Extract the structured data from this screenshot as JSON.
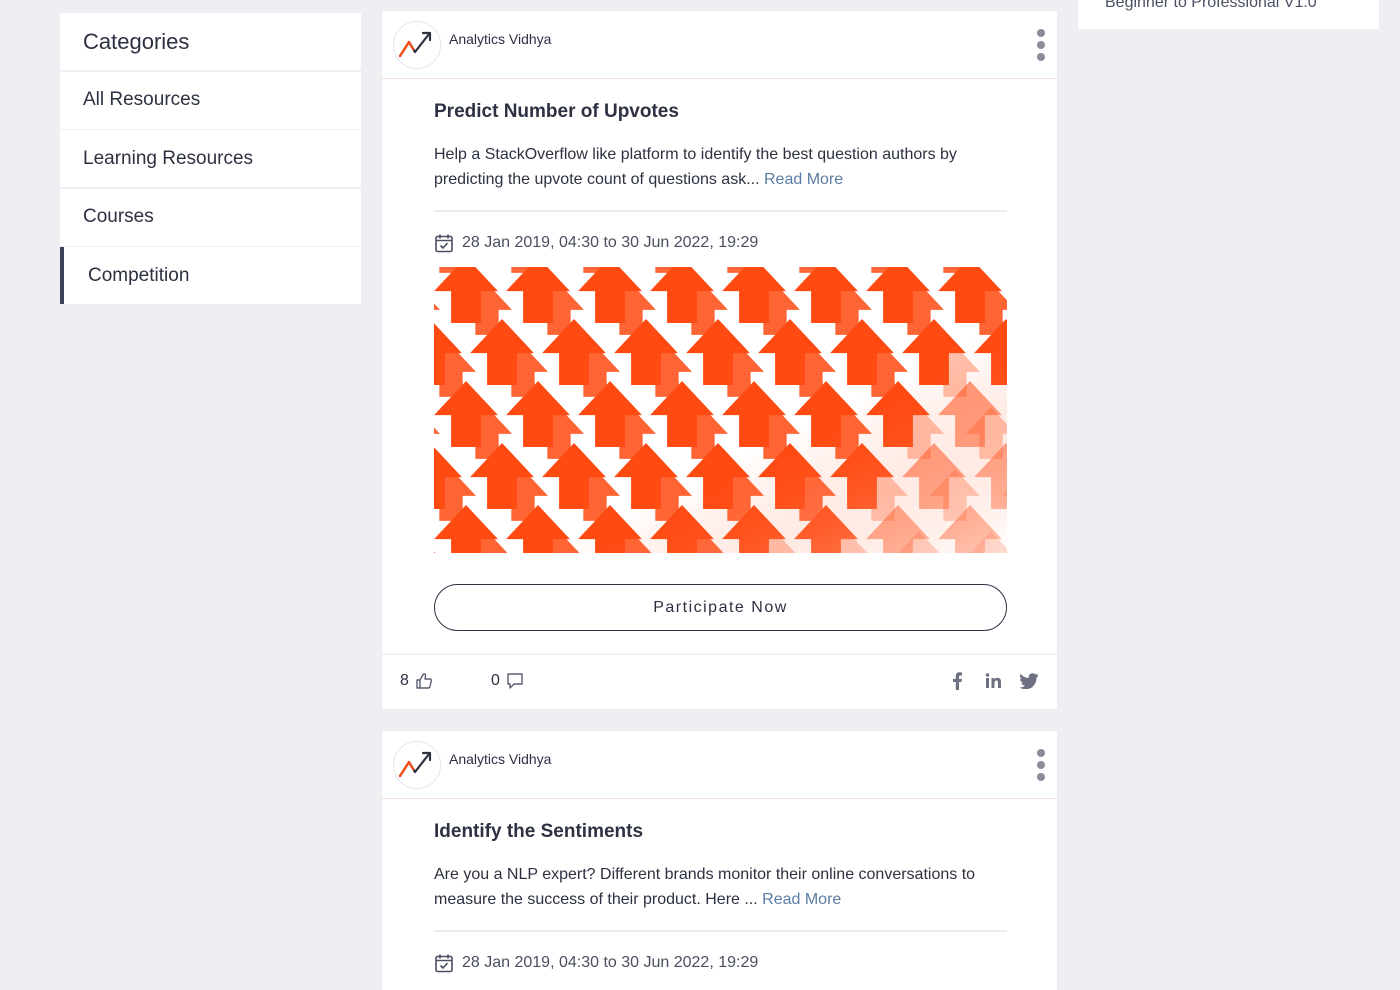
{
  "sidebar": {
    "header": "Categories",
    "items": [
      {
        "label": "All Resources"
      },
      {
        "label": "Learning Resources"
      },
      {
        "label": "Courses"
      },
      {
        "label": "Competition",
        "active": true
      }
    ]
  },
  "right_widget": {
    "text": "Beginner to Professional V1.0"
  },
  "cards": [
    {
      "author": "Analytics Vidhya",
      "title": "Predict Number of Upvotes",
      "description": "Help a StackOverflow like platform to identify the best question authors by predicting the upvote count of questions ask...",
      "read_more": "Read More",
      "date_range": "28 Jan 2019, 04:30 to 30 Jun 2022, 19:29",
      "button": "Participate Now",
      "likes": "8",
      "comments": "0"
    },
    {
      "author": "Analytics Vidhya",
      "title": "Identify the Sentiments",
      "description": "Are you a NLP expert? Different brands monitor their online conversations to measure the success of their product. Here ...",
      "read_more": "Read More",
      "date_range": "28 Jan 2019, 04:30 to 30 Jun 2022, 19:29"
    }
  ],
  "colors": {
    "background": "#eeeff2",
    "accent_orange": "#ff4a12",
    "text_dark": "#2d3142",
    "link": "#5b7ca3"
  },
  "icons": [
    "kebab-menu-icon",
    "calendar-check-icon",
    "thumbs-up-icon",
    "comment-icon",
    "facebook-icon",
    "linkedin-icon",
    "twitter-icon",
    "analytics-vidhya-logo"
  ]
}
